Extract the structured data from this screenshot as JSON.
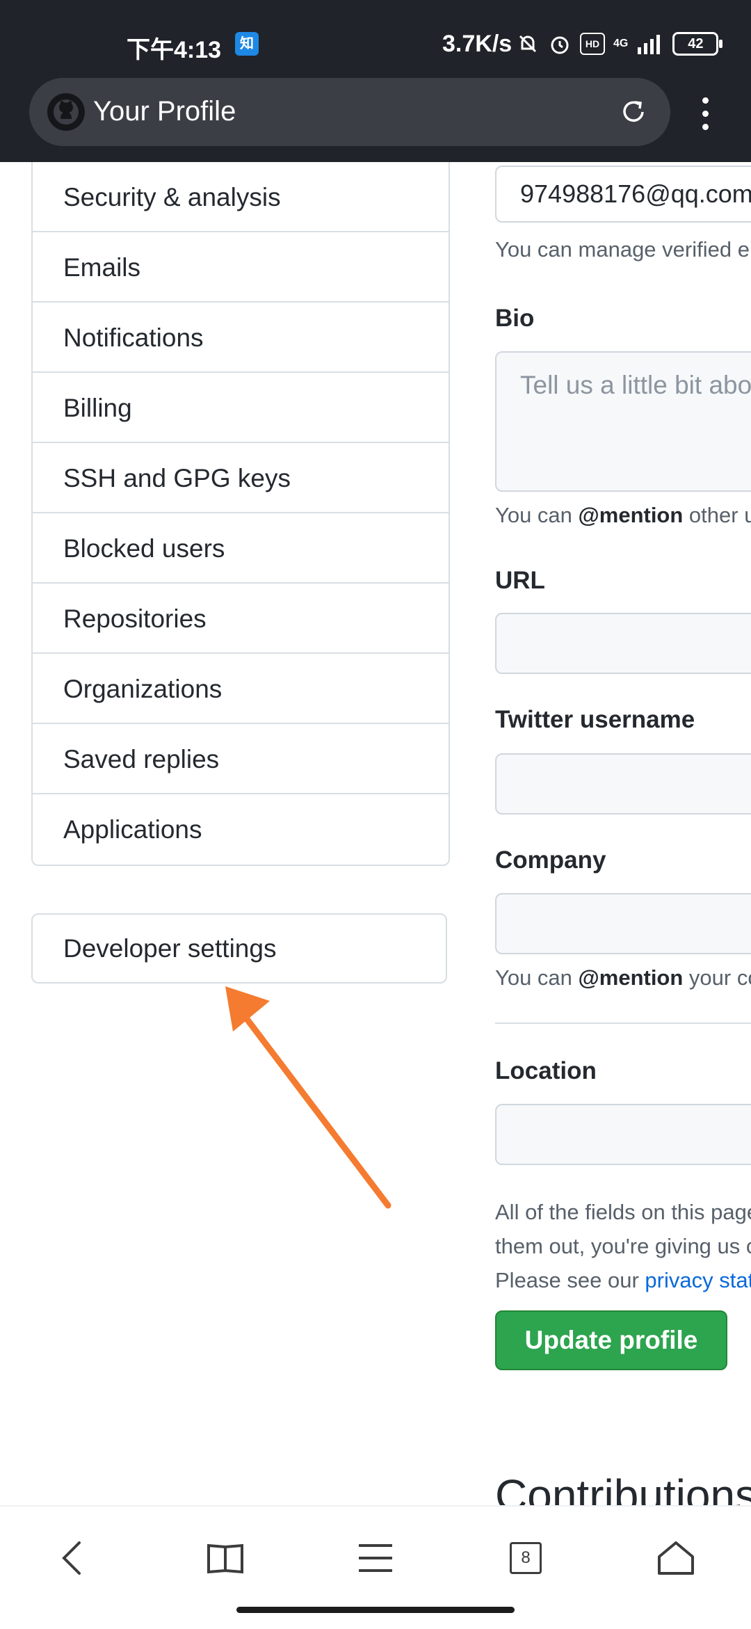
{
  "status_bar": {
    "time": "下午4:13",
    "app_badge": "知",
    "net_speed": "3.7K/s",
    "hd_label": "HD",
    "network": "4G",
    "battery": "42"
  },
  "browser": {
    "page_title": "Your Profile"
  },
  "settings_menu": {
    "items": [
      {
        "label": "Security & analysis"
      },
      {
        "label": "Emails"
      },
      {
        "label": "Notifications"
      },
      {
        "label": "Billing"
      },
      {
        "label": "SSH and GPG keys"
      },
      {
        "label": "Blocked users"
      },
      {
        "label": "Repositories"
      },
      {
        "label": "Organizations"
      },
      {
        "label": "Saved replies"
      },
      {
        "label": "Applications"
      }
    ],
    "developer_settings": "Developer settings"
  },
  "profile_form": {
    "email_value": "974988176@qq.com",
    "email_note": "You can manage verified email addresses",
    "bio_label": "Bio",
    "bio_placeholder": "Tell us a little bit about yourself",
    "bio_note_prefix": "You can ",
    "bio_note_mention": "@mention",
    "bio_note_suffix": " other users and organizations",
    "url_label": "URL",
    "twitter_label": "Twitter username",
    "company_label": "Company",
    "company_note_prefix": "You can ",
    "company_note_mention": "@mention",
    "company_note_suffix": " your company's GitHub organization",
    "location_label": "Location",
    "privacy_line1": "All of the fields on this page are optional and can be deleted at any time, and by filling",
    "privacy_line2": "them out, you're giving us consent to share this data wherever your user profile appears.",
    "privacy_line3_prefix": "Please see our ",
    "privacy_link": "privacy statement",
    "update_button": "Update profile",
    "contributions_heading": "Contributions"
  },
  "bottom_nav": {
    "tab_count": "8"
  },
  "colors": {
    "annotation_arrow": "#f47b30",
    "primary_button": "#2da44e",
    "link": "#0969da"
  }
}
